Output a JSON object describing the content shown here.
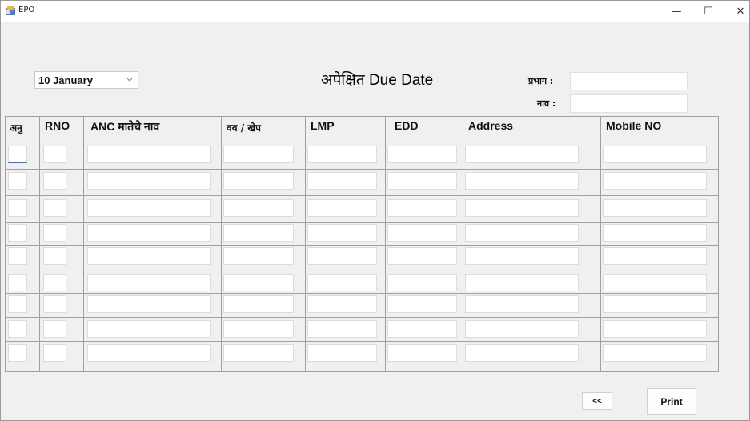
{
  "window": {
    "title": "EPO",
    "minimize": "—",
    "maximize": "☐",
    "close": "✕"
  },
  "form": {
    "date_value": "10  January",
    "heading": "अपेक्षित Due Date",
    "prabhag_label": "प्रभाग :",
    "naav_label": "नाव :",
    "prabhag_value": "",
    "naav_value": ""
  },
  "table": {
    "headers": [
      "अनु",
      "RNO",
      "ANC मातेचे नाव",
      "वय / खेप",
      "LMP",
      "EDD",
      "Address",
      "Mobile NO"
    ],
    "row_count": 9
  },
  "buttons": {
    "back": "<<",
    "print": "Print"
  },
  "colors": {
    "background": "#f0f0f0",
    "focus": "#3b6fd1"
  }
}
